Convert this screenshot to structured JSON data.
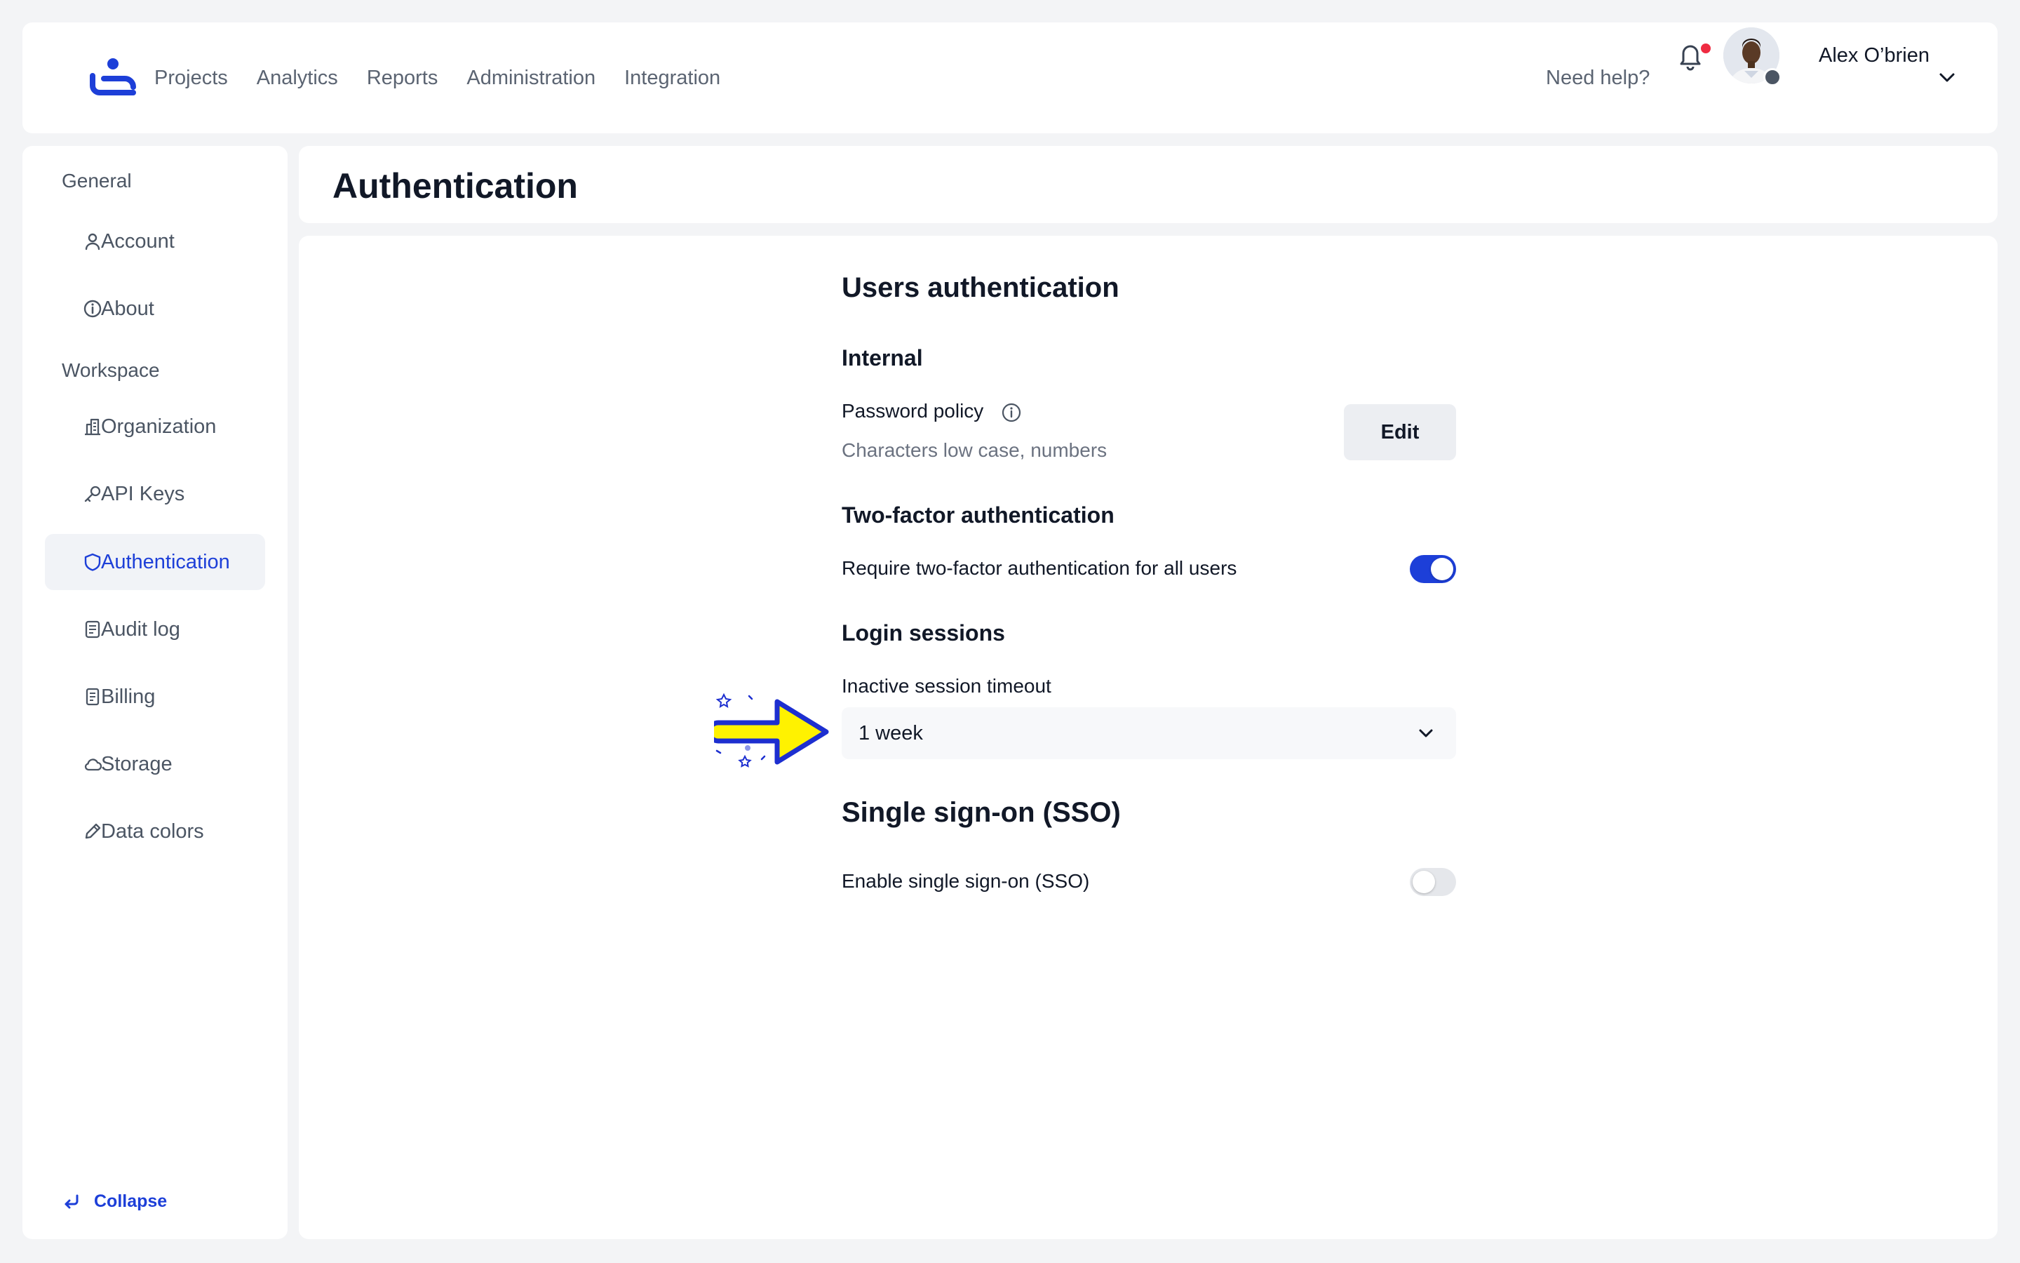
{
  "nav": {
    "items": [
      "Projects",
      "Analytics",
      "Reports",
      "Administration",
      "Integration"
    ],
    "help": "Need help?",
    "user_name": "Alex O’brien"
  },
  "sidebar": {
    "general_label": "General",
    "workspace_label": "Workspace",
    "general_items": [
      {
        "label": "Account",
        "icon": "user-icon"
      },
      {
        "label": "About",
        "icon": "info-icon"
      }
    ],
    "workspace_items": [
      {
        "label": "Organization",
        "icon": "building-icon"
      },
      {
        "label": "API Keys",
        "icon": "key-icon"
      },
      {
        "label": "Authentication",
        "icon": "shield-icon",
        "active": true
      },
      {
        "label": "Audit log",
        "icon": "document-list-icon"
      },
      {
        "label": "Billing",
        "icon": "receipt-icon"
      },
      {
        "label": "Storage",
        "icon": "cloud-icon"
      },
      {
        "label": "Data colors",
        "icon": "pen-icon"
      }
    ],
    "collapse": "Collapse"
  },
  "page": {
    "title": "Authentication"
  },
  "auth": {
    "section_title": "Users authentication",
    "internal": {
      "title": "Internal",
      "password_policy_label": "Password policy",
      "password_policy_desc": "Characters low case, numbers",
      "edit_label": "Edit"
    },
    "two_factor": {
      "title": "Two-factor authentication",
      "require_label": "Require two-factor authentication for all users",
      "enabled": true
    },
    "sessions": {
      "title": "Login sessions",
      "timeout_label": "Inactive session timeout",
      "timeout_value": "1 week"
    },
    "sso": {
      "title": "Single sign-on (SSO)",
      "enable_label": "Enable single sign-on (SSO)",
      "enabled": false
    }
  },
  "colors": {
    "accent": "#1d3fd8",
    "notification": "#ef2b41",
    "arrow_fill": "#fff200"
  }
}
